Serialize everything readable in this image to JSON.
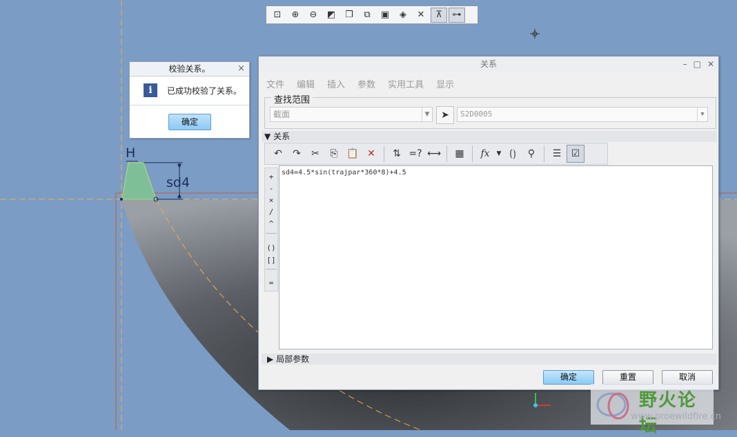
{
  "toolbar": {
    "icons": [
      "zoom-fit-icon",
      "zoom-in-icon",
      "zoom-out-icon",
      "repaint-icon",
      "orient-icon",
      "saved-views-icon",
      "display-style-icon",
      "datum-display-icon",
      "spin-center-icon",
      "annotation-display-icon",
      "point-display-icon"
    ]
  },
  "sketch": {
    "dim_label": "sd4",
    "h_label": "H"
  },
  "info_dialog": {
    "title": "校验关系。",
    "message": "已成功校验了关系。",
    "ok": "确定",
    "close_glyph": "×"
  },
  "relations_dialog": {
    "title": "关系",
    "menu": [
      "文件",
      "编辑",
      "插入",
      "参数",
      "实用工具",
      "显示"
    ],
    "search_scope_label": "查找范围",
    "scope_value": "截面",
    "object_value": "S2D0005",
    "section_label": "关系",
    "relation_text": "sd4=4.5*sin(trajpar*360*8)+4.5",
    "local_params_label": "局部参数",
    "operators": [
      "+",
      "-",
      "×",
      "/",
      "^",
      "()",
      "[]",
      "="
    ],
    "buttons": {
      "ok": "确定",
      "reset": "重置",
      "cancel": "取消"
    },
    "fx_label": "fx"
  },
  "watermark": {
    "title": "野火论坛",
    "url": "www.proewildfire.cn"
  },
  "colors": {
    "background": "#7b9cc4",
    "model_dark": "#4d5156",
    "accent_button": "#8ccaf4",
    "watermark_green": "#4f9a3b"
  }
}
